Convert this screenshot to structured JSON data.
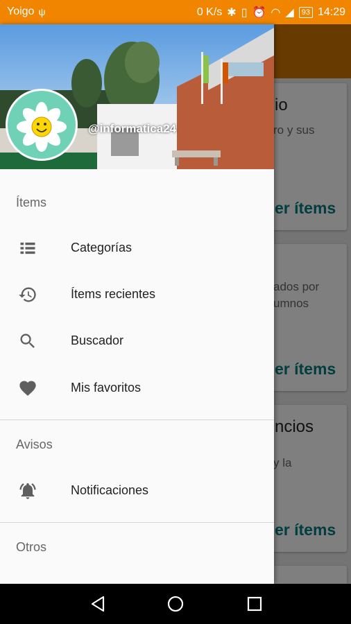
{
  "status_bar": {
    "carrier": "Yoigo",
    "speed": "0 K/s",
    "battery": "93",
    "time": "14:29"
  },
  "background_cards": [
    {
      "title": "io",
      "desc": [
        "ro y sus"
      ],
      "action": "er ítems"
    },
    {
      "title": "",
      "desc": [
        "ados por",
        "umnos"
      ],
      "action": "er ítems"
    },
    {
      "title": "ncios",
      "desc": [
        "y la"
      ],
      "action": "er ítems"
    }
  ],
  "drawer": {
    "header": {
      "handle": "@informatica24"
    },
    "sections": [
      {
        "label": "Ítems"
      },
      {
        "label": "Avisos"
      },
      {
        "label": "Otros"
      }
    ],
    "items": [
      {
        "label": "Categorías",
        "icon": "list-icon"
      },
      {
        "label": "Ítems recientes",
        "icon": "history-icon"
      },
      {
        "label": "Buscador",
        "icon": "search-icon"
      },
      {
        "label": "Mis favoritos",
        "icon": "heart-icon"
      },
      {
        "label": "Notificaciones",
        "icon": "bell-icon"
      }
    ]
  },
  "colors": {
    "status_bar": "#f28500",
    "app_bar": "#cc7400",
    "accent": "#007c80",
    "icon": "#5f5f5f"
  }
}
